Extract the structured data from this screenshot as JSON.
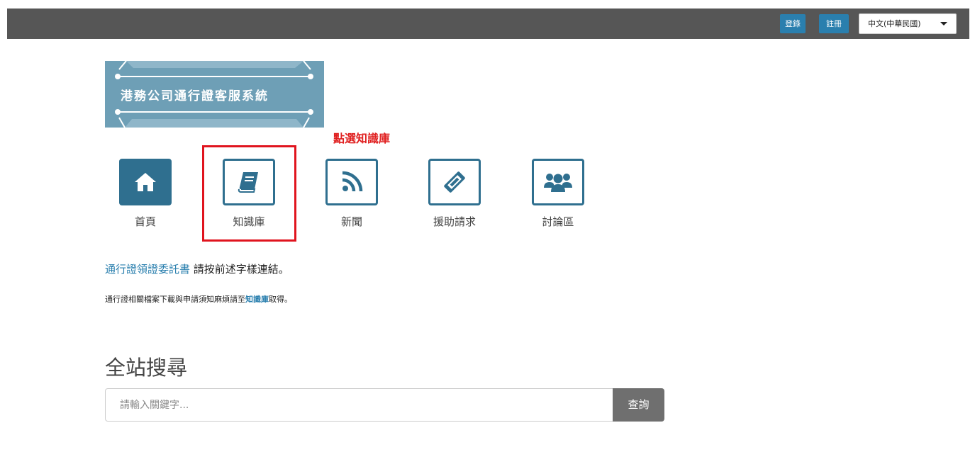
{
  "header": {
    "login_label": "登錄",
    "register_label": "註冊",
    "language": "中文(中華民國)"
  },
  "banner": {
    "title": "港務公司通行證客服系統"
  },
  "annotation": {
    "hint": "點選知識庫"
  },
  "nav": [
    {
      "label": "首頁",
      "icon": "home-icon"
    },
    {
      "label": "知識庫",
      "icon": "book-icon"
    },
    {
      "label": "新聞",
      "icon": "rss-icon"
    },
    {
      "label": "援助請求",
      "icon": "ticket-icon"
    },
    {
      "label": "討論區",
      "icon": "users-icon"
    }
  ],
  "notice": {
    "link_text": "通行證領證委託書",
    "text": "請按前述字樣連結。",
    "line2_prefix": "通行證相關檔案下載與申請須知麻煩請至",
    "line2_link": "知識庫",
    "line2_suffix": "取得。"
  },
  "search": {
    "title": "全站搜尋",
    "placeholder": "請輸入關鍵字...",
    "button_label": "查詢"
  },
  "colors": {
    "accent": "#2f6f8f",
    "link": "#2a7fae",
    "highlight": "#e0141e",
    "topbar": "#565656"
  }
}
